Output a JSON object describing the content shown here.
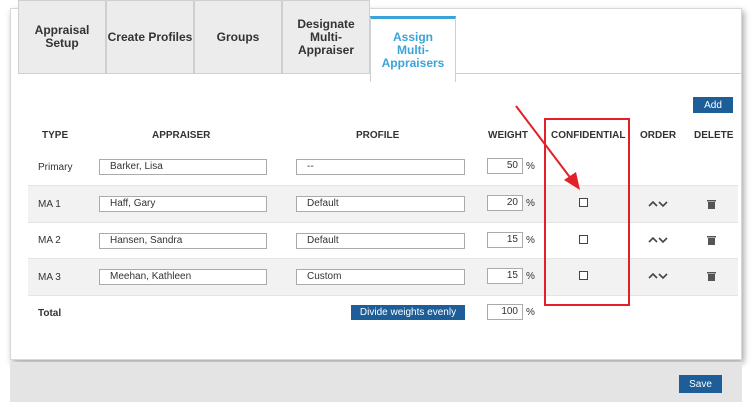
{
  "tabs": [
    {
      "label": "Appraisal Setup"
    },
    {
      "label": "Create Profiles"
    },
    {
      "label": "Groups"
    },
    {
      "label": "Designate Multi-Appraiser"
    },
    {
      "label": "Assign Multi-Appraisers"
    }
  ],
  "active_tab": "Assign Multi-Appraisers",
  "add_button": "Add",
  "headers": {
    "type": "TYPE",
    "appraiser": "APPRAISER",
    "profile": "PROFILE",
    "weight": "WEIGHT",
    "confidential": "CONFIDENTIAL",
    "order": "ORDER",
    "delete": "DELETE"
  },
  "rows": [
    {
      "type": "Primary",
      "appraiser": "Barker, Lisa",
      "profile": "--",
      "weight": "50",
      "pct": "%",
      "confidential": null
    },
    {
      "type": "MA 1",
      "appraiser": "Haff, Gary",
      "profile": "Default",
      "weight": "20",
      "pct": "%",
      "confidential": false
    },
    {
      "type": "MA 2",
      "appraiser": "Hansen, Sandra",
      "profile": "Default",
      "weight": "15",
      "pct": "%",
      "confidential": false
    },
    {
      "type": "MA 3",
      "appraiser": "Meehan, Kathleen",
      "profile": "Custom",
      "weight": "15",
      "pct": "%",
      "confidential": false
    }
  ],
  "total": {
    "label": "Total",
    "weight": "100",
    "pct": "%"
  },
  "divide_button": "Divide weights evenly",
  "save_button": "Save",
  "colors": {
    "accent": "#3aa4d8",
    "button": "#1d5d98",
    "highlight": "#e32028"
  },
  "icons": {
    "order": "chevron-up-down-icon",
    "delete": "trash-icon",
    "annotation": "arrow-icon"
  }
}
